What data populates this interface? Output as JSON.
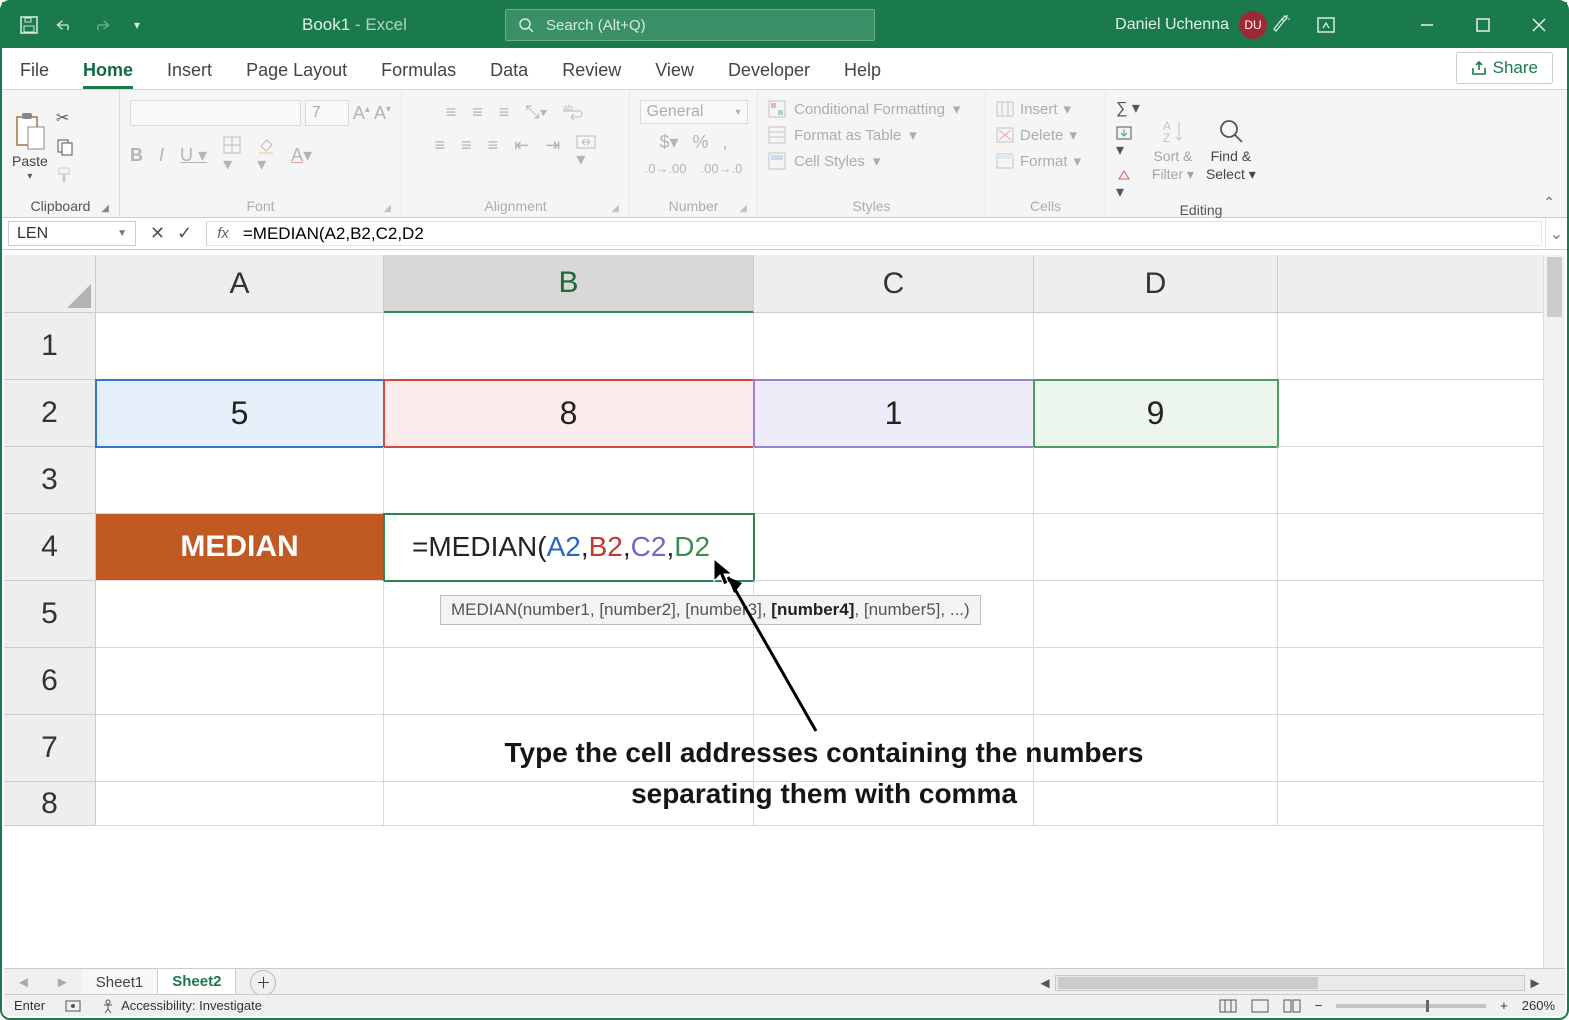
{
  "title": {
    "book": "Book1",
    "app": "Excel",
    "user": "Daniel Uchenna",
    "initials": "DU",
    "search_placeholder": "Search (Alt+Q)"
  },
  "tabs": {
    "file": "File",
    "home": "Home",
    "insert": "Insert",
    "pagelayout": "Page Layout",
    "formulas": "Formulas",
    "data": "Data",
    "review": "Review",
    "view": "View",
    "developer": "Developer",
    "help": "Help",
    "share": "Share"
  },
  "groups": {
    "clipboard": "Clipboard",
    "paste": "Paste",
    "font": "Font",
    "font_size": "7",
    "alignment": "Alignment",
    "number": "Number",
    "number_format": "General",
    "styles": "Styles",
    "cond": "Conditional Formatting",
    "table": "Format as Table",
    "cellstyles": "Cell Styles",
    "cells": "Cells",
    "insert": "Insert",
    "delete": "Delete",
    "format": "Format",
    "editing": "Editing",
    "sortfilter1": "Sort &",
    "sortfilter2": "Filter",
    "find1": "Find &",
    "find2": "Select"
  },
  "namebox": "LEN",
  "formula": "=MEDIAN(A2,B2,C2,D2",
  "columns": [
    "A",
    "B",
    "C",
    "D"
  ],
  "rows": [
    "1",
    "2",
    "3",
    "4",
    "5",
    "6",
    "7",
    "8"
  ],
  "cells": {
    "a2": "5",
    "b2": "8",
    "c2": "1",
    "d2": "9",
    "a4": "MEDIAN",
    "b4_prefix": "=MEDIAN(",
    "b4_a": "A2",
    "b4_b": "B2",
    "b4_c": "C2",
    "b4_d": "D2"
  },
  "tooltip": {
    "pre": "MEDIAN(number1, [number2], [number3], ",
    "bold": "[number4]",
    "post": ", [number5], ...)"
  },
  "annotation1": "Type the cell addresses containing the numbers",
  "annotation2": "separating them with comma",
  "sheets": {
    "s1": "Sheet1",
    "s2": "Sheet2"
  },
  "status": {
    "mode": "Enter",
    "acc": "Accessibility: Investigate",
    "zoom": "260%"
  }
}
